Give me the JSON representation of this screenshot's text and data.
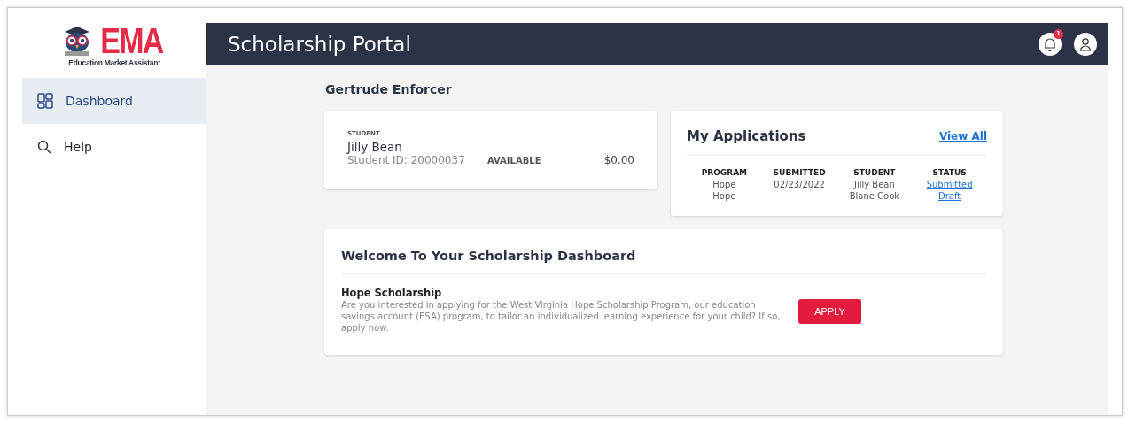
{
  "logo": {
    "wordmark": "EMA",
    "tagline": "Education Market Assistant"
  },
  "sidebar": {
    "items": [
      {
        "label": "Dashboard",
        "kind": "dashboard",
        "selected": true
      },
      {
        "label": "Help",
        "kind": "help",
        "selected": false
      }
    ]
  },
  "header": {
    "title": "Scholarship Portal",
    "notification_count": "1"
  },
  "account_name": "Gertrude Enforcer",
  "student_card": {
    "caption": "STUDENT",
    "name": "Jilly Bean",
    "student_id": "Student ID: 20000037",
    "balance_label": "AVAILABLE",
    "balance": "$0.00"
  },
  "applications": {
    "title": "My Applications",
    "link": "View All",
    "columns": [
      "PROGRAM",
      "SUBMITTED",
      "STUDENT",
      "STATUS"
    ],
    "rows": [
      {
        "program": "Hope",
        "submitted": "02/23/2022",
        "student": "Jilly Bean",
        "status": "Submitted"
      },
      {
        "program": "Hope",
        "student": "Blane Cook",
        "status": "Draft"
      }
    ]
  },
  "welcome": {
    "title": "Welcome To Your Scholarship Dashboard",
    "program": "Hope Scholarship",
    "description": "Are you interested in applying for the West Virginia Hope Scholarship Program, our education savings account (ESA) program, to tailor an individualized learning experience for your child? If so, apply now.",
    "button": "APPLY"
  }
}
